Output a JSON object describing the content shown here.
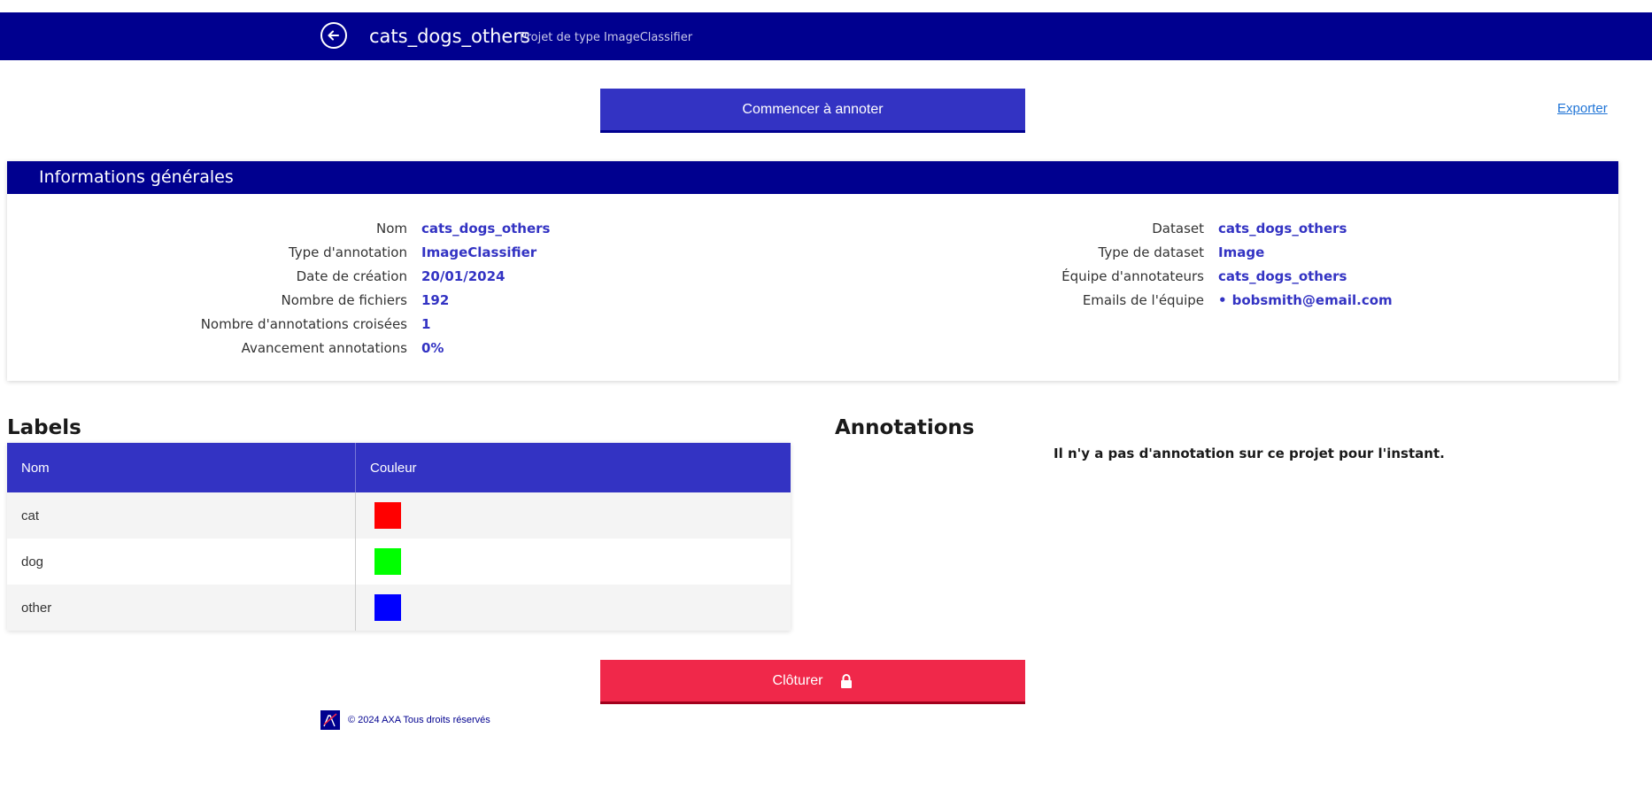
{
  "header": {
    "title": "cats_dogs_others",
    "subtitle": "Projet de type ImageClassifier",
    "back_icon": "arrow-left-icon"
  },
  "actions": {
    "start_label": "Commencer à annoter",
    "export_label": "Exporter",
    "close_label": "Clôturer",
    "close_icon": "lock-icon"
  },
  "info": {
    "title": "Informations générales",
    "left": [
      {
        "label": "Nom",
        "value": "cats_dogs_others"
      },
      {
        "label": "Type d'annotation",
        "value": "ImageClassifier"
      },
      {
        "label": "Date de création",
        "value": "20/01/2024"
      },
      {
        "label": "Nombre de fichiers",
        "value": "192"
      },
      {
        "label": "Nombre d'annotations croisées",
        "value": "1"
      },
      {
        "label": "Avancement annotations",
        "value": "0%"
      }
    ],
    "right": [
      {
        "label": "Dataset",
        "value": "cats_dogs_others"
      },
      {
        "label": "Type de dataset",
        "value": "Image"
      },
      {
        "label": "Équipe d'annotateurs",
        "value": "cats_dogs_others"
      },
      {
        "label": "Emails de l'équipe",
        "value": "bobsmith@email.com"
      }
    ]
  },
  "labels": {
    "title": "Labels",
    "columns": [
      "Nom",
      "Couleur"
    ],
    "rows": [
      {
        "name": "cat",
        "color": "#ff0000"
      },
      {
        "name": "dog",
        "color": "#00ff00"
      },
      {
        "name": "other",
        "color": "#0000ff"
      }
    ]
  },
  "annotations": {
    "title": "Annotations",
    "empty_message": "Il n'y a pas d'annotation sur ce projet pour l'instant."
  },
  "footer": {
    "copyright": "© 2024 AXA Tous droits réservés",
    "logo_icon": "axa-logo-icon"
  },
  "colors": {
    "primary": "#00008f",
    "accent": "#3333c3",
    "danger": "#f0284a",
    "link": "#1f74d6"
  }
}
